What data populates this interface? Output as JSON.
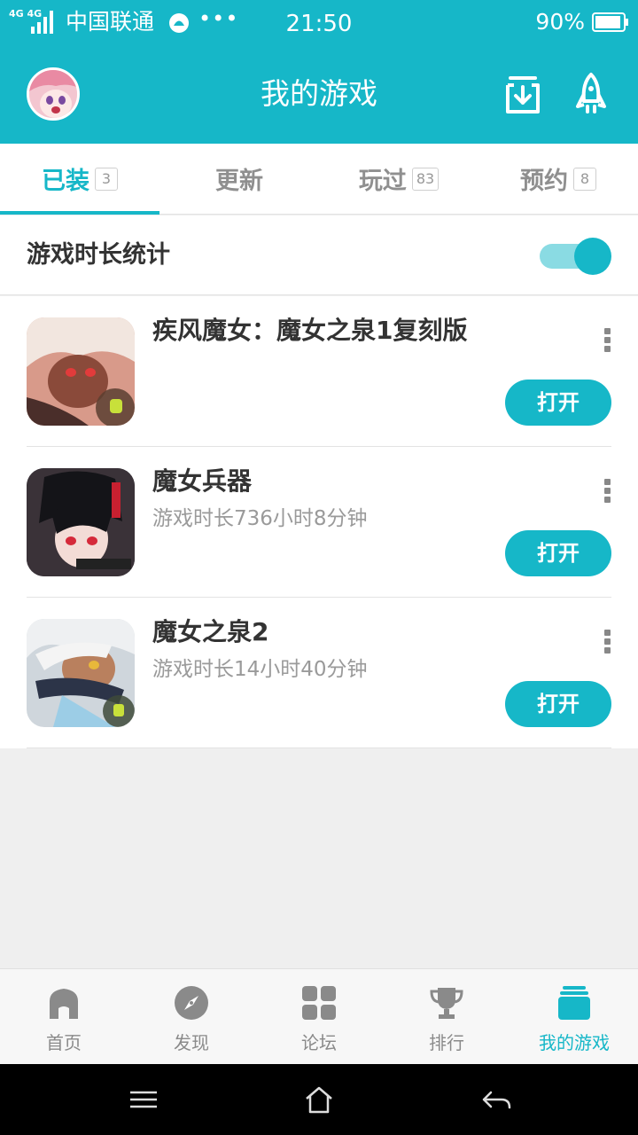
{
  "status_bar": {
    "network_top": "4G 4G",
    "carrier": "中国联通",
    "dots": "•••",
    "time": "21:50",
    "battery": "90%"
  },
  "header": {
    "title": "我的游戏",
    "icons": [
      "avatar",
      "download-icon",
      "rocket-icon"
    ]
  },
  "tabs": [
    {
      "label": "已装",
      "badge": "3",
      "active": true
    },
    {
      "label": "更新",
      "badge": "",
      "active": false
    },
    {
      "label": "玩过",
      "badge": "83",
      "active": false
    },
    {
      "label": "预约",
      "badge": "8",
      "active": false
    }
  ],
  "stats": {
    "label": "游戏时长统计",
    "toggle_on": true
  },
  "games": [
    {
      "name": "疾风魔女：魔女之泉1复刻版",
      "playtime": "",
      "button": "打开"
    },
    {
      "name": "魔女兵器",
      "playtime": "游戏时长736小时8分钟",
      "button": "打开"
    },
    {
      "name": "魔女之泉2",
      "playtime": "游戏时长14小时40分钟",
      "button": "打开"
    }
  ],
  "bottom_nav": [
    {
      "label": "首页",
      "icon": "home-icon",
      "active": false
    },
    {
      "label": "发现",
      "icon": "compass-icon",
      "active": false
    },
    {
      "label": "论坛",
      "icon": "grid-icon",
      "active": false
    },
    {
      "label": "排行",
      "icon": "trophy-icon",
      "active": false
    },
    {
      "label": "我的游戏",
      "icon": "my-games-icon",
      "active": true
    }
  ],
  "colors": {
    "accent": "#16b7c8",
    "background": "#efefef"
  }
}
